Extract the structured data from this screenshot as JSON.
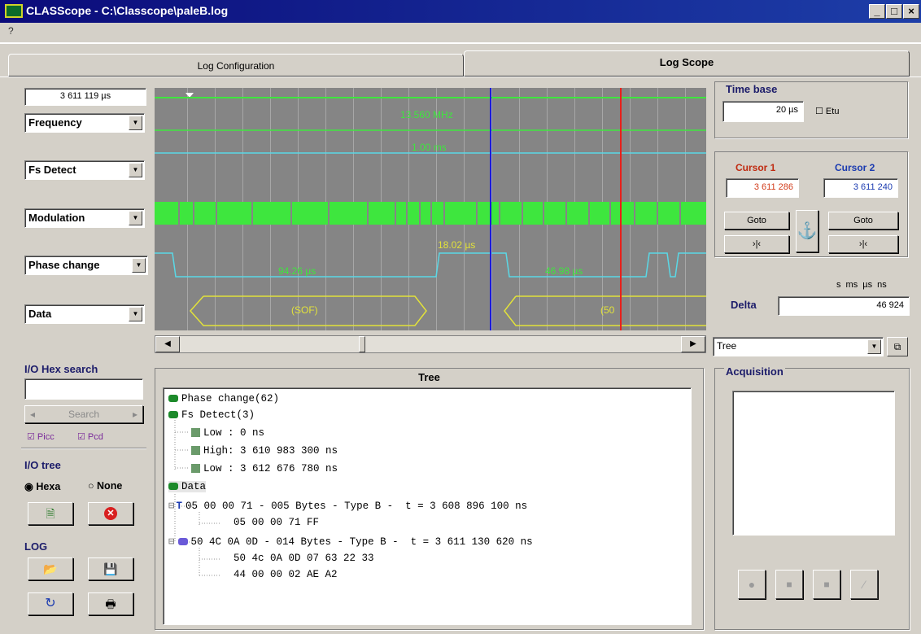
{
  "window": {
    "title": "CLASScope - C:\\Classcope\\paleB.log"
  },
  "menu": {
    "help": "?"
  },
  "tabs": [
    {
      "label": "Log Configuration"
    },
    {
      "label": "Log Scope"
    }
  ],
  "left": {
    "time_value": "3 611 119 µs",
    "channels": [
      {
        "label": "Frequency"
      },
      {
        "label": "Fs Detect"
      },
      {
        "label": "Modulation"
      },
      {
        "label": "Phase change"
      },
      {
        "label": "Data"
      }
    ],
    "hex_search": {
      "title": "I/O Hex search",
      "value": "",
      "search_label": "Search",
      "picc": "Picc",
      "pcd": "Pcd"
    },
    "io_tree": {
      "title": "I/O tree",
      "hexa": "Hexa",
      "none": "None"
    },
    "log": {
      "title": "LOG"
    }
  },
  "scope": {
    "labels": {
      "freq": "13.560 MHz",
      "fs": "1.00 ms",
      "phase1": "94.26 µs",
      "phase2": "18.02 µs",
      "phase3": "46.98 µs",
      "sof": "(SOF)",
      "data2": "(50"
    }
  },
  "right": {
    "time_base": {
      "title": "Time base",
      "value": "20 µs",
      "etu": "Etu"
    },
    "cursor1": {
      "title": "Cursor 1",
      "value": "3 611 286"
    },
    "cursor2": {
      "title": "Cursor 2",
      "value": "3 611 240"
    },
    "goto": "Goto",
    "jump": "›|‹",
    "delta": {
      "label": "Delta",
      "units": "s  ms  µs  ns",
      "value": "46 924"
    },
    "view_select": "Tree",
    "acquisition": {
      "title": "Acquisition"
    }
  },
  "tree": {
    "title": "Tree",
    "rows": [
      {
        "text": "Phase change(62)"
      },
      {
        "text": "Fs Detect(3)"
      },
      {
        "text": "Low : 0 ns"
      },
      {
        "text": "High: 3 610 983 300 ns"
      },
      {
        "text": "Low : 3 612 676 780 ns"
      },
      {
        "text": "Data"
      },
      {
        "text": "05 00 00 71 - 005 Bytes - Type B -  t = 3 608 896 100 ns"
      },
      {
        "text": "05 00 00 71 FF"
      },
      {
        "text": "50 4C 0A 0D - 014 Bytes - Type B -  t = 3 611 130 620 ns"
      },
      {
        "text": "50 4c 0A 0D 07 63 22 33"
      },
      {
        "text": "44 00 00 02 AE A2"
      }
    ]
  },
  "colors": {
    "trace": "#3ee63e",
    "cursor1": "#e8201a",
    "cursor2": "#1a1ad8",
    "sof": "#e2e23a",
    "cyan": "#5ad8e6"
  }
}
